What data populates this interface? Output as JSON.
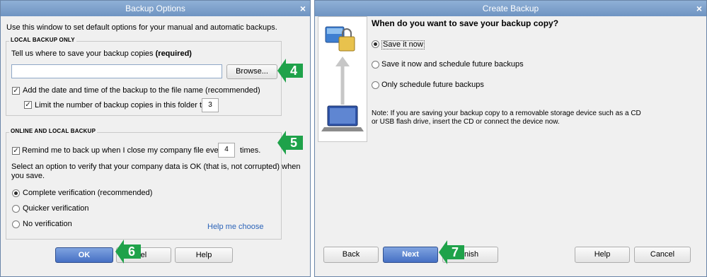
{
  "colors": {
    "marker_green": "#1fa24a",
    "title_blue": "#7ba0cd",
    "link_blue": "#2b63b8"
  },
  "backup_options": {
    "title": "Backup Options",
    "close": "×",
    "intro": "Use this window to set default options for your manual and automatic backups.",
    "local": {
      "title": "LOCAL BACKUP ONLY",
      "prompt": "Tell us where to save your backup copies",
      "required": "(required)",
      "path_value": "",
      "browse": "Browse...",
      "add_date_label": "Add the date and time of the backup to the file name (recommended)",
      "add_date_checked": true,
      "limit_label": "Limit the number of backup copies in this folder to",
      "limit_checked": true,
      "limit_value": "3"
    },
    "online": {
      "title": "ONLINE AND LOCAL BACKUP",
      "remind_label": "Remind me to back up when I close my company file every",
      "remind_checked": true,
      "remind_value": "4",
      "times": "times.",
      "verify_prompt_1": "Select an option to verify that your company data is OK (that is, not corrupted) when",
      "verify_prompt_2": "you save.",
      "options": [
        "Complete verification (recommended)",
        "Quicker verification",
        "No verification"
      ],
      "selected": 0,
      "help_link": "Help me choose"
    },
    "buttons": {
      "ok": "OK",
      "cancel": "ncel",
      "help": "Help"
    }
  },
  "create_backup": {
    "title": "Create Backup",
    "close": "×",
    "question": "When do you want to save your backup copy?",
    "options": [
      "Save it now",
      "Save it now and schedule future backups",
      "Only schedule future backups"
    ],
    "selected": 0,
    "note_1": "Note: If you are saving your backup copy to a removable storage device such as a CD",
    "note_2": "or USB flash drive, insert the CD or connect the device now.",
    "buttons": {
      "back": "Back",
      "next": "Next",
      "finish": "nish",
      "help": "Help",
      "cancel": "Cancel"
    }
  },
  "markers": [
    "4",
    "5",
    "6",
    "7"
  ]
}
